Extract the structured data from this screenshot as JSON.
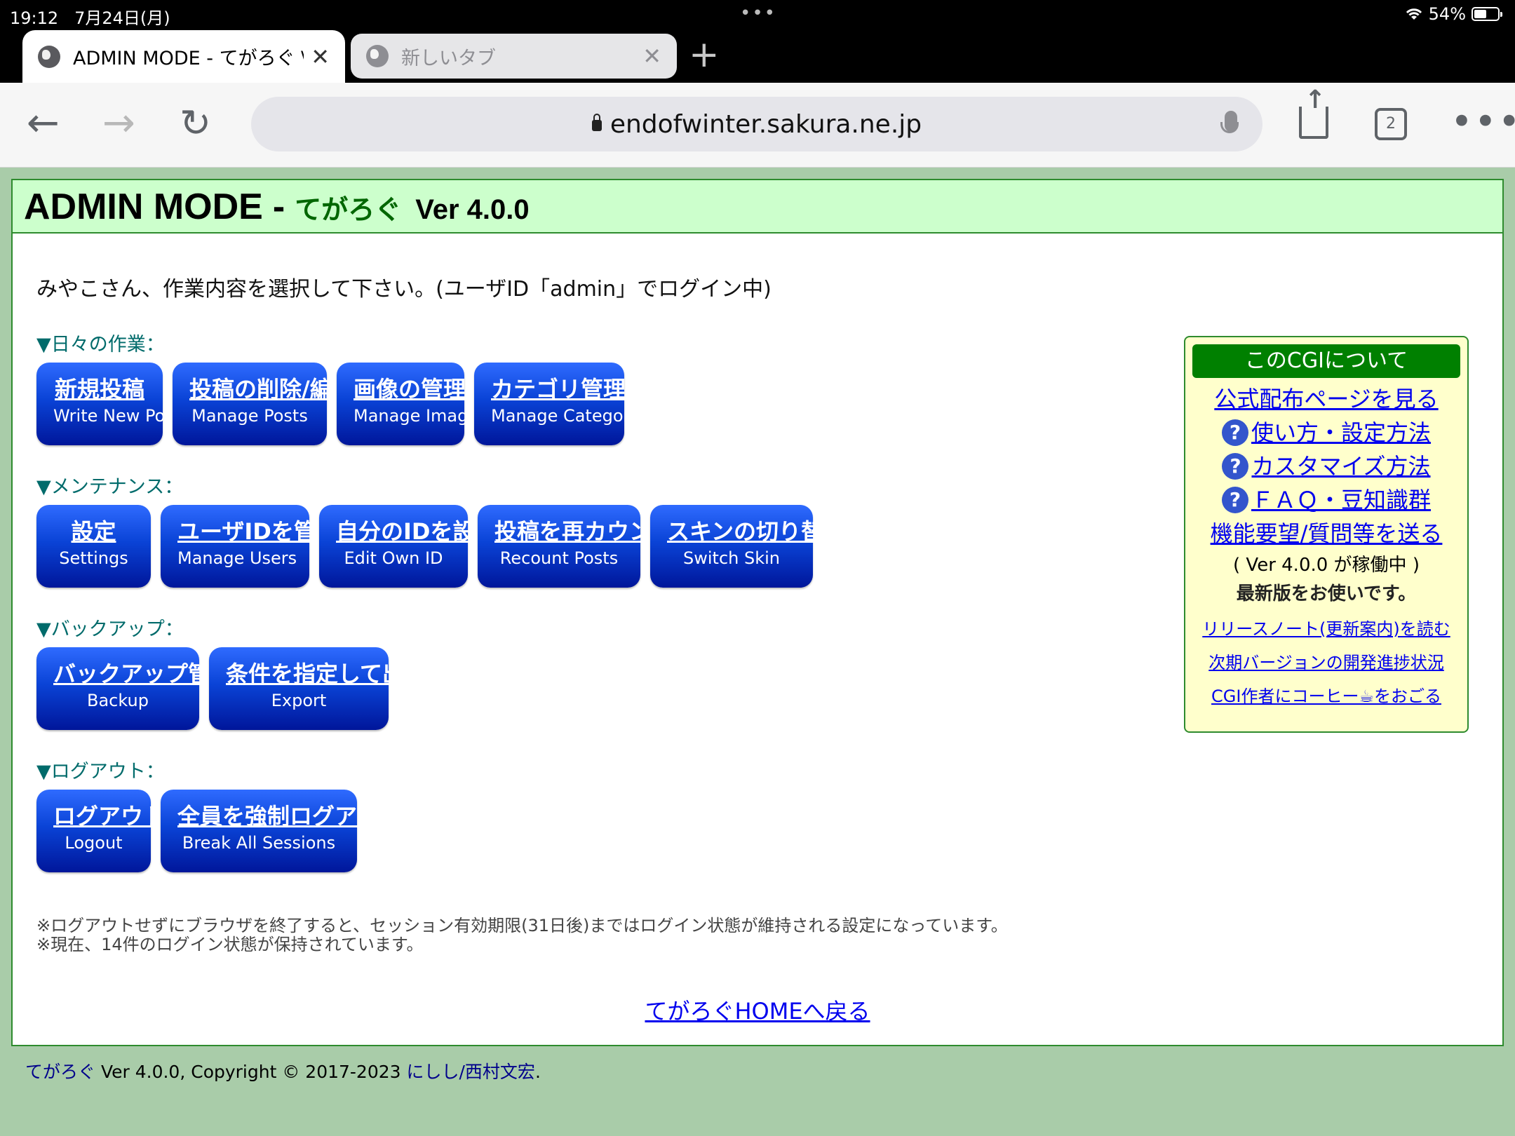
{
  "status_bar": {
    "time": "19:12",
    "date": "7月24日(月)",
    "battery": "54%",
    "battery_level": 0.54,
    "icons": [
      "wifi-icon",
      "battery-icon"
    ]
  },
  "tabs": [
    {
      "title": "ADMIN MODE - てがろぐ \\",
      "active": true
    },
    {
      "title": "新しいタブ",
      "active": false
    }
  ],
  "toolbar": {
    "url": "endofwinter.sakura.ne.jp",
    "tab_count": "2"
  },
  "page": {
    "header": {
      "title": "ADMIN MODE",
      "dash": "-",
      "app_name": "てがろぐ",
      "version": "Ver 4.0.0"
    },
    "greeting": "みやこさん、作業内容を選択して下さい。(ユーザID「admin」でログイン中)",
    "sections": [
      {
        "title": "▼日々の作業：",
        "buttons": [
          {
            "jp": "新規投稿",
            "en": "Write New Post"
          },
          {
            "jp": "投稿の削除/編集",
            "en": "Manage Posts"
          },
          {
            "jp": "画像の管理",
            "en": "Manage Images"
          },
          {
            "jp": "カテゴリ管理",
            "en": "Manage Categories"
          }
        ]
      },
      {
        "title": "▼メンテナンス：",
        "buttons": [
          {
            "jp": "設定",
            "en": "Settings"
          },
          {
            "jp": "ユーザIDを管理",
            "en": "Manage Users"
          },
          {
            "jp": "自分のIDを設定",
            "en": "Edit Own ID"
          },
          {
            "jp": "投稿を再カウント",
            "en": "Recount Posts"
          },
          {
            "jp": "スキンの切り替え",
            "en": "Switch Skin"
          }
        ]
      },
      {
        "title": "▼バックアップ：",
        "buttons": [
          {
            "jp": "バックアップ管理",
            "en": "Backup"
          },
          {
            "jp": "条件を指定して出力",
            "en": "Export"
          }
        ]
      },
      {
        "title": "▼ログアウト：",
        "buttons": [
          {
            "jp": "ログアウト",
            "en": "Logout"
          },
          {
            "jp": "全員を強制ログアウト",
            "en": "Break All Sessions"
          }
        ]
      }
    ],
    "notes": [
      "※ログアウトせずにブラウザを終了すると、セッション有効期限(31日後)まではログイン状態が維持される設定になっています。",
      "※現在、14件のログイン状態が保持されています。"
    ],
    "home_link": "てがろぐHOMEへ戻る",
    "sidebox": {
      "title": "このCGIについて",
      "official_link": "公式配布ページを見る",
      "help_links": [
        "使い方・設定方法",
        "カスタマイズ方法",
        "ＦＡＱ・豆知識群"
      ],
      "help_icon": "?",
      "request_link": "機能要望/質問等を送る",
      "running": "( Ver 4.0.0 が稼働中 )",
      "latest": "最新版をお使いです。",
      "small_links": [
        "リリースノート(更新案内)を読む",
        "次期バージョンの開発進捗状況",
        "CGI作者にコーヒー☕をおごる"
      ]
    },
    "footer": {
      "app_name": "てがろぐ",
      "text": " Ver 4.0.0, Copyright © 2017-2023 ",
      "author": "にしし/西村文宏",
      "end": "."
    }
  }
}
